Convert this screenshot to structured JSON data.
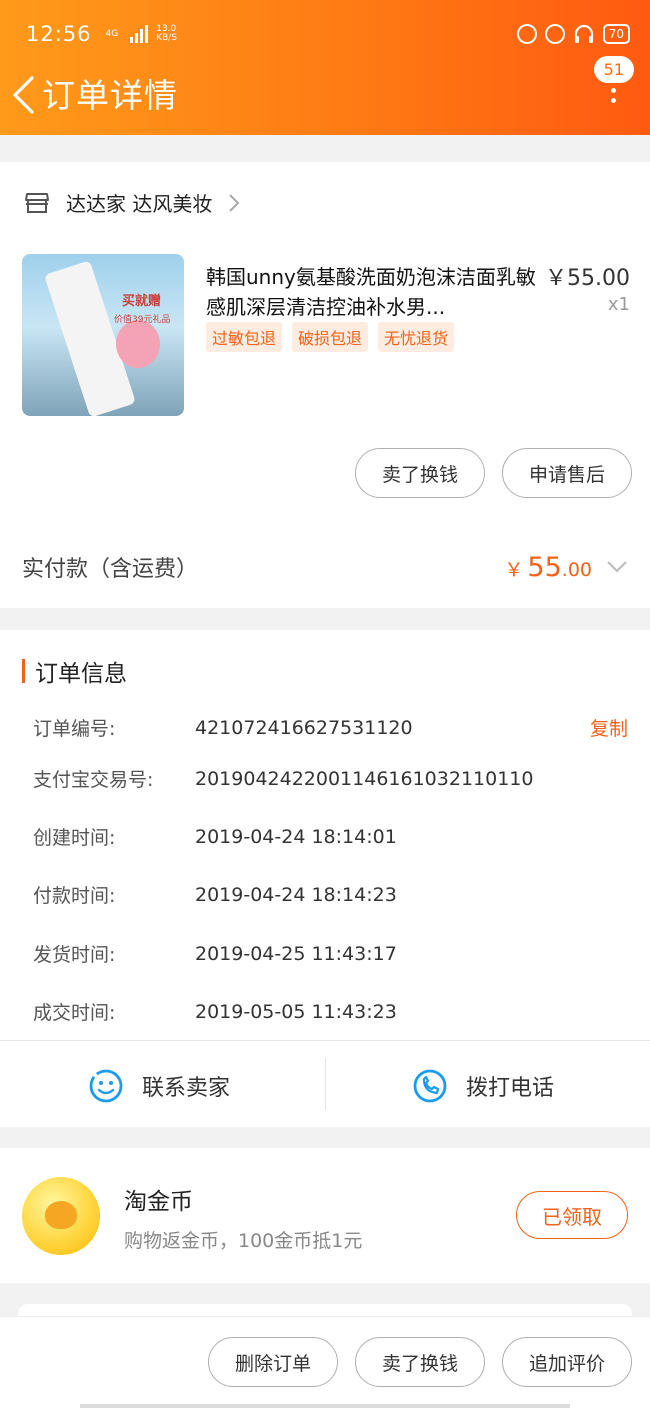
{
  "status_bar": {
    "time": "12:56",
    "net_type": "4G",
    "net_speed_value": "13.0",
    "net_speed_unit": "KB/S",
    "battery": "70"
  },
  "header": {
    "title": "订单详情",
    "message_badge": "51"
  },
  "shop": {
    "name": "达达家 达风美妆"
  },
  "product": {
    "title": "韩国unny氨基酸洗面奶泡沫洁面乳敏感肌深层清洁控油补水男...",
    "price": "￥55.00",
    "quantity": "x1",
    "image_text_1": "买就赠",
    "image_text_2": "价值39元礼品",
    "tags": [
      "过敏包退",
      "破损包退",
      "无忧退货"
    ]
  },
  "actions": {
    "sell_exchange": "卖了换钱",
    "after_sale": "申请售后"
  },
  "payment": {
    "label": "实付款（含运费）",
    "currency": "￥",
    "amount_int": "55",
    "amount_dec": ".00"
  },
  "order_info": {
    "title": "订单信息",
    "copy_label": "复制",
    "rows": [
      {
        "label": "订单编号:",
        "value": "421072416627531120"
      },
      {
        "label": "支付宝交易号:",
        "value": "2019042422001146161032110110"
      },
      {
        "label": "创建时间:",
        "value": "2019-04-24 18:14:01"
      },
      {
        "label": "付款时间:",
        "value": "2019-04-24 18:14:23"
      },
      {
        "label": "发货时间:",
        "value": "2019-04-25 11:43:17"
      },
      {
        "label": "成交时间:",
        "value": "2019-05-05 11:43:23"
      }
    ],
    "contact_seller": "联系卖家",
    "call_phone": "拨打电话"
  },
  "coins": {
    "title": "淘金币",
    "desc": "购物返金币，100金币抵1元",
    "button": "已领取"
  },
  "bottom_bar": {
    "delete_order": "删除订单",
    "sell_exchange": "卖了换钱",
    "add_review": "追加评价"
  },
  "colors": {
    "accent": "#f0631a",
    "header_start": "#ff9a1a",
    "header_end": "#ff5a10"
  }
}
